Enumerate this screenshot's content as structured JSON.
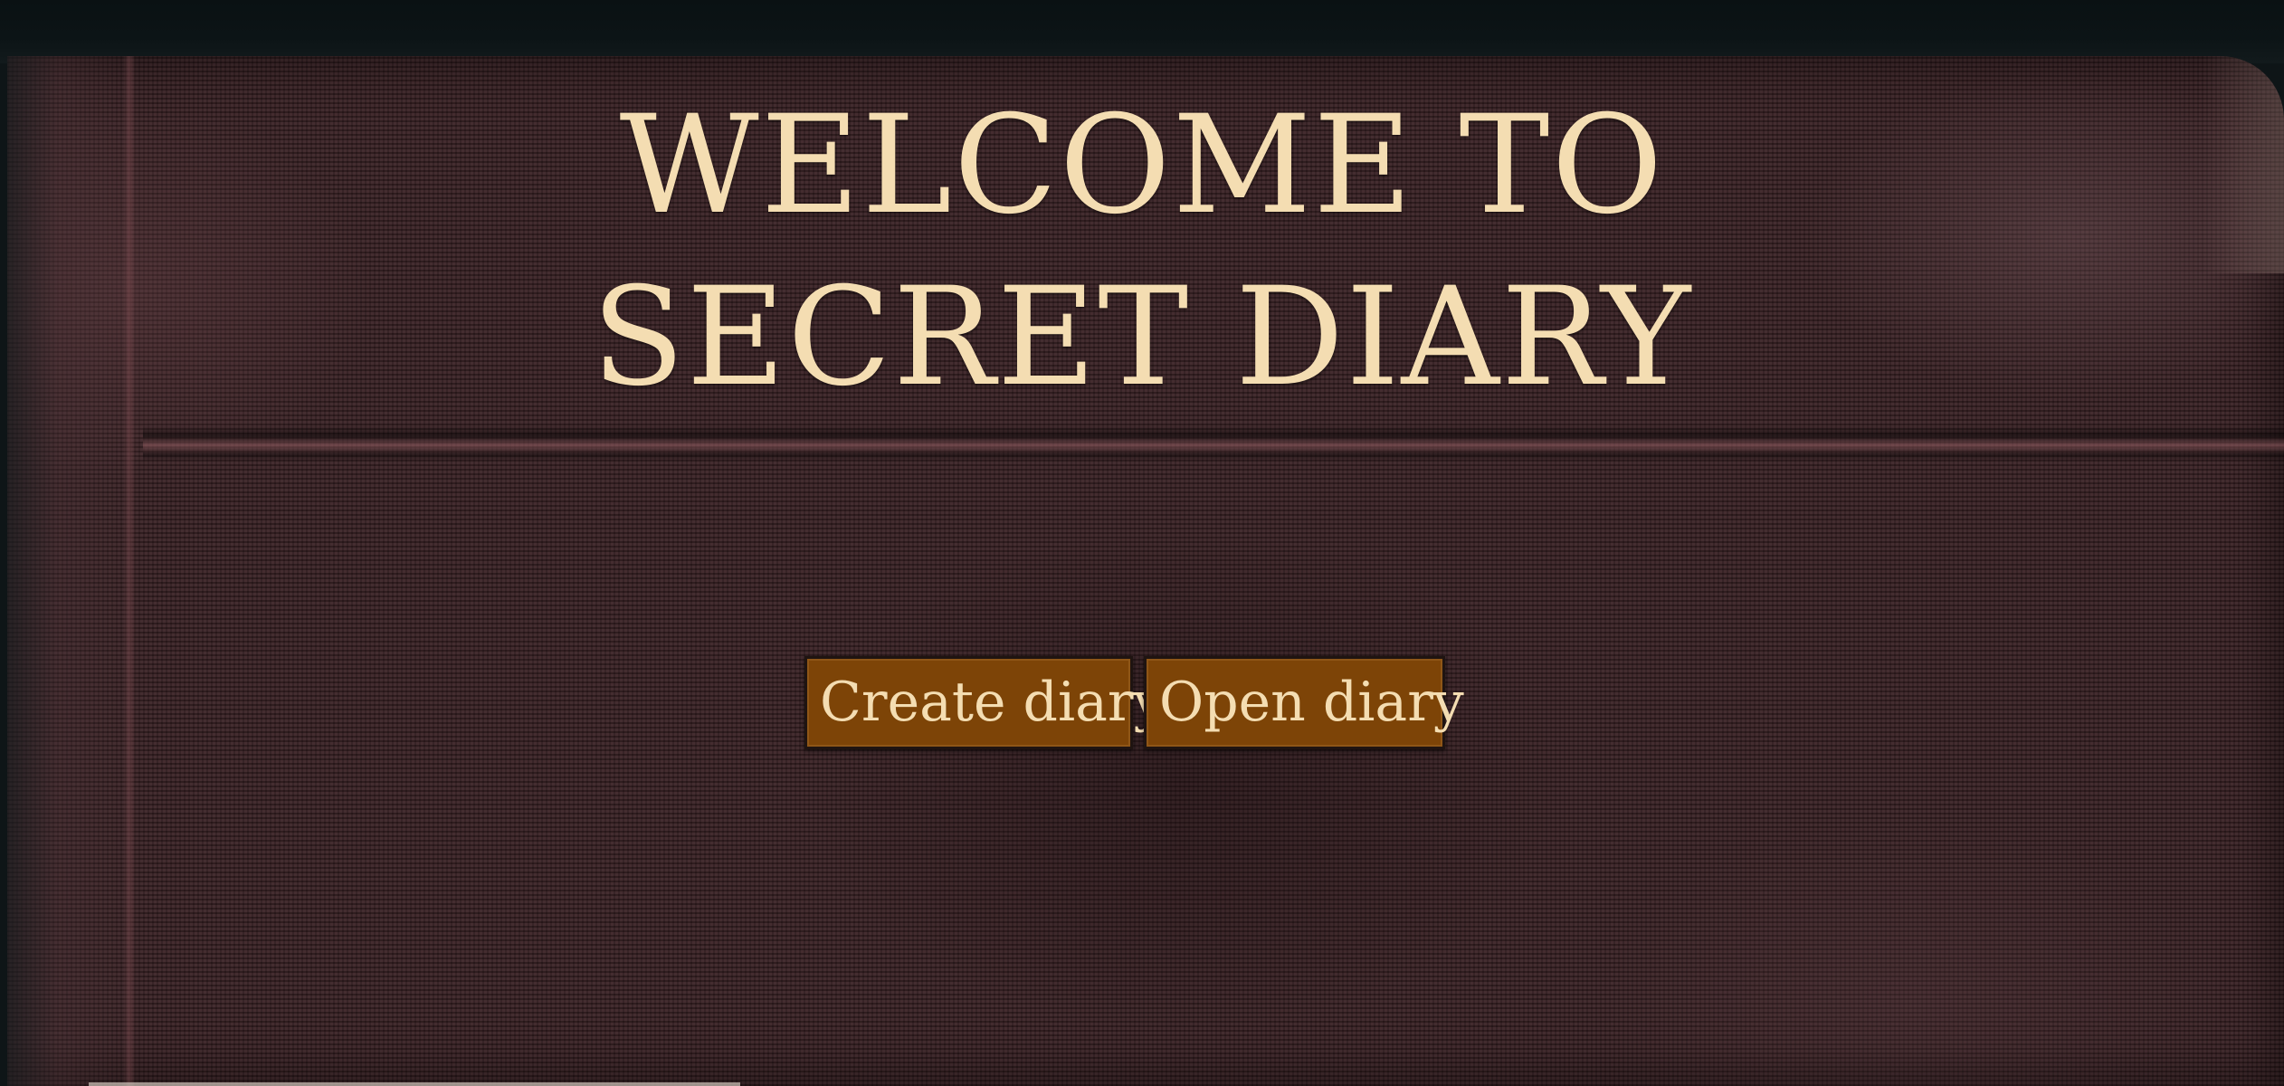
{
  "page": {
    "title_line_1": "WELCOME TO",
    "title_line_2": "SECRET DIARY"
  },
  "actions": {
    "create_label": "Create diary",
    "open_label": "Open diary"
  },
  "colors": {
    "cover": "#3a2225",
    "title_text": "#f4ddb2",
    "button_bg": "#7d4407",
    "button_border": "#1f1411"
  }
}
